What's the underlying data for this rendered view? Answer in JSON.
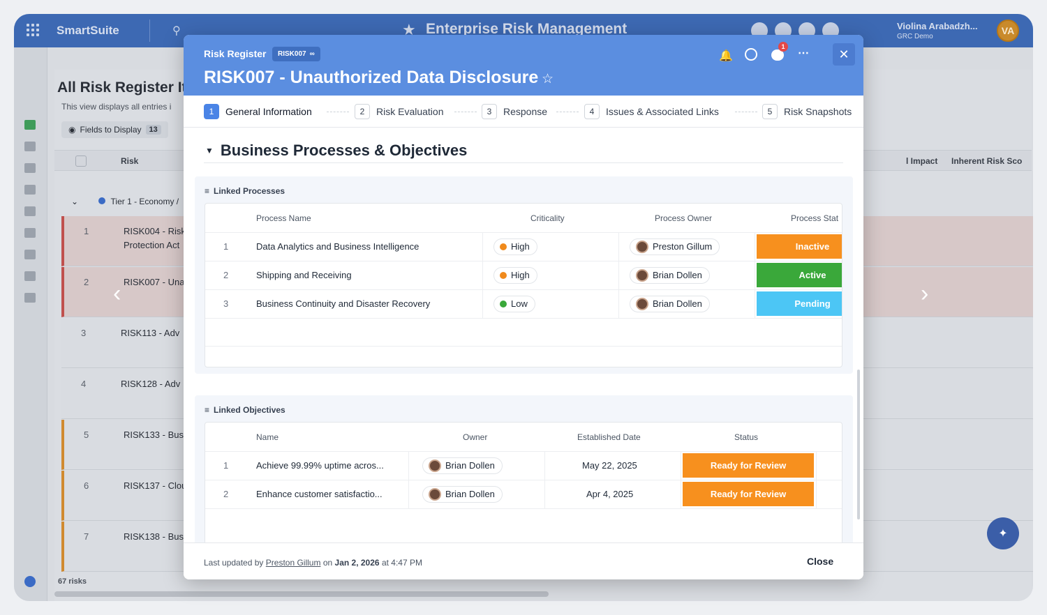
{
  "app": {
    "brand": "SmartSuite",
    "title": "Enterprise Risk Management",
    "user_name": "Violina Arabadzh...",
    "user_sub": "GRC Demo",
    "user_initials": "VA"
  },
  "background": {
    "view_title": "All Risk Register It",
    "view_desc": "This view displays all entries i",
    "fields_label": "Fields to Display",
    "fields_count": "13",
    "col_risk": "Risk",
    "col_impact": "l Impact",
    "col_score": "Inherent Risk Sco",
    "tier": "Tier 1 - Economy /",
    "rows": [
      {
        "n": "1",
        "t": "RISK004 - Risk",
        "t2": "Protection Act"
      },
      {
        "n": "2",
        "t": "RISK007 - Una",
        "t2": ""
      },
      {
        "n": "3",
        "t": "RISK113 - Adv",
        "t2": ""
      },
      {
        "n": "4",
        "t": "RISK128 - Adv",
        "t2": ""
      },
      {
        "n": "5",
        "t": "RISK133 - Bus",
        "t2": ""
      },
      {
        "n": "6",
        "t": "RISK137 - Clou",
        "t2": ""
      },
      {
        "n": "7",
        "t": "RISK138 - Bus",
        "t2": ""
      }
    ],
    "count": "67 risks"
  },
  "modal": {
    "breadcrumb": "Risk Register",
    "record_id": "RISK007",
    "title": "RISK007 - Unauthorized Data Disclosure",
    "notification_count": "1",
    "steps": [
      {
        "num": "1",
        "label": "General Information"
      },
      {
        "num": "2",
        "label": "Risk Evaluation"
      },
      {
        "num": "3",
        "label": "Response"
      },
      {
        "num": "4",
        "label": "Issues & Associated Links"
      },
      {
        "num": "5",
        "label": "Risk Snapshots"
      }
    ],
    "section_title": "Business Processes & Objectives",
    "processes": {
      "title": "Linked Processes",
      "headers": [
        "Process Name",
        "Criticality",
        "Process Owner",
        "Process Stat"
      ],
      "rows": [
        {
          "n": "1",
          "name": "Data Analytics and Business Intelligence",
          "crit": "High",
          "crit_color": "#f08a1c",
          "owner": "Preston Gillum",
          "status": "Inactive",
          "status_color": "#f7901e"
        },
        {
          "n": "2",
          "name": "Shipping and Receiving",
          "crit": "High",
          "crit_color": "#f08a1c",
          "owner": "Brian Dollen",
          "status": "Active",
          "status_color": "#3aa83a"
        },
        {
          "n": "3",
          "name": "Business Continuity and Disaster Recovery",
          "crit": "Low",
          "crit_color": "#3aa83a",
          "owner": "Brian Dollen",
          "status": "Pending",
          "status_color": "#4cc6f5"
        }
      ]
    },
    "objectives": {
      "title": "Linked Objectives",
      "headers": [
        "Name",
        "Owner",
        "Established Date",
        "Status"
      ],
      "rows": [
        {
          "n": "1",
          "name": "Achieve 99.99% uptime acros...",
          "owner": "Brian Dollen",
          "date": "May 22, 2025",
          "status": "Ready for Review",
          "status_color": "#f7901e"
        },
        {
          "n": "2",
          "name": "Enhance customer satisfactio...",
          "owner": "Brian Dollen",
          "date": "Apr 4, 2025",
          "status": "Ready for Review",
          "status_color": "#f7901e"
        }
      ]
    },
    "footer": {
      "prefix": "Last updated",
      "by": "by",
      "user": "Preston Gillum",
      "on": "on",
      "date": "Jan 2, 2026",
      "at": "at",
      "time": "4:47 PM",
      "close": "Close"
    }
  },
  "colors": {
    "header_blue": "#5b8ee0",
    "topbar": "#3d69b3",
    "step_active": "#4a84e6"
  }
}
